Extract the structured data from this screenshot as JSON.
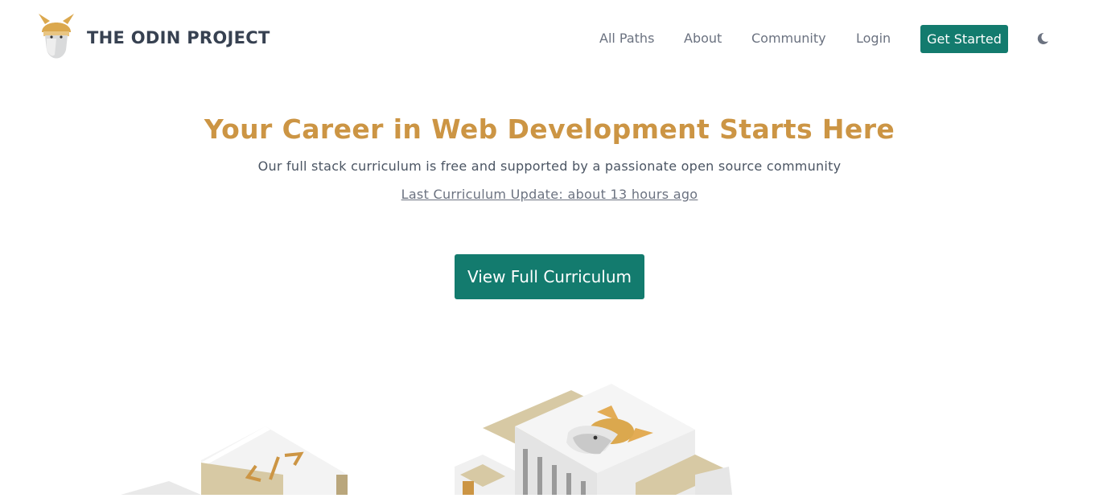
{
  "header": {
    "brand": "THE ODIN PROJECT",
    "nav": {
      "all_paths": "All Paths",
      "about": "About",
      "community": "Community",
      "login": "Login",
      "get_started": "Get Started"
    },
    "theme_toggle_icon": "moon-icon"
  },
  "hero": {
    "title": "Your Career in Web Development Starts Here",
    "subtitle": "Our full stack curriculum is free and supported by a passionate open source community",
    "last_update": "Last Curriculum Update: about 13 hours ago",
    "cta": "View Full Curriculum"
  },
  "colors": {
    "primary": "#137b6e",
    "accent": "#cc9544",
    "text": "#374151",
    "muted": "#6b7280"
  }
}
